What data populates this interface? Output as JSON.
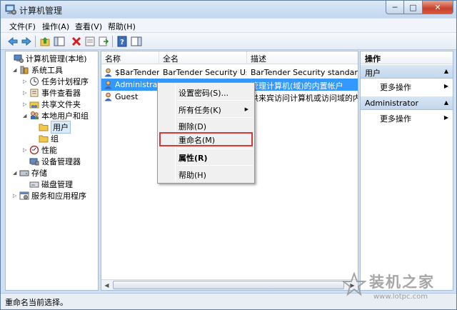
{
  "window": {
    "title": "计算机管理",
    "buttons": {
      "minimize": "─",
      "maximize": "□",
      "close": "✕"
    }
  },
  "menu": [
    {
      "label": "文件(F)"
    },
    {
      "label": "操作(A)"
    },
    {
      "label": "查看(V)"
    },
    {
      "label": "帮助(H)"
    }
  ],
  "toolbar": {
    "icons": [
      "back-arrow-icon",
      "forward-arrow-icon",
      "up-folder-icon",
      "show-hide-tree-icon",
      "delete-icon",
      "properties-icon",
      "export-list-icon",
      "help-icon",
      "show-hide-action-pane-icon"
    ]
  },
  "tree": [
    {
      "label": "计算机管理(本地)",
      "icon": "computer-management-icon"
    },
    {
      "label": "系统工具",
      "icon": "tools-icon"
    },
    {
      "label": "任务计划程序",
      "icon": "clock-icon"
    },
    {
      "label": "事件查看器",
      "icon": "event-viewer-icon"
    },
    {
      "label": "共享文件夹",
      "icon": "shared-folder-icon"
    },
    {
      "label": "本地用户和组",
      "icon": "users-group-icon"
    },
    {
      "label": "用户",
      "icon": "folder-icon"
    },
    {
      "label": "组",
      "icon": "folder-icon"
    },
    {
      "label": "性能",
      "icon": "performance-icon"
    },
    {
      "label": "设备管理器",
      "icon": "device-manager-icon"
    },
    {
      "label": "存储",
      "icon": "storage-icon"
    },
    {
      "label": "磁盘管理",
      "icon": "disk-icon"
    },
    {
      "label": "服务和应用程序",
      "icon": "services-icon"
    }
  ],
  "list": {
    "columns": [
      "名称",
      "全名",
      "描述"
    ],
    "rows": [
      {
        "name": "$BarTender...",
        "fullname": "BarTender Security Us...",
        "description": "BarTender Security standard u..."
      },
      {
        "name": "Administrat...",
        "fullname": "",
        "description": "管理计算机(域)的内置帐户"
      },
      {
        "name": "Guest",
        "fullname": "",
        "description": "供来宾访问计算机或访问域的内..."
      }
    ]
  },
  "context_menu": {
    "items": [
      {
        "label": "设置密码(S)..."
      },
      {
        "label": "所有任务(K)"
      },
      {
        "label": "删除(D)"
      },
      {
        "label": "重命名(M)"
      },
      {
        "label": "属性(R)"
      },
      {
        "label": "帮助(H)"
      }
    ],
    "highlight_color": "#d03a3a"
  },
  "actions": {
    "header": "操作",
    "sections": [
      {
        "title": "用户",
        "item": "更多操作"
      },
      {
        "title": "Administrator",
        "item": "更多操作"
      }
    ]
  },
  "status": {
    "text": "重命名当前选择。"
  },
  "watermark": {
    "title": "装机之家",
    "url": "www.lotpc.com"
  },
  "colors": {
    "selection": "#3399ff",
    "window_frame": "#cfe0f3"
  }
}
